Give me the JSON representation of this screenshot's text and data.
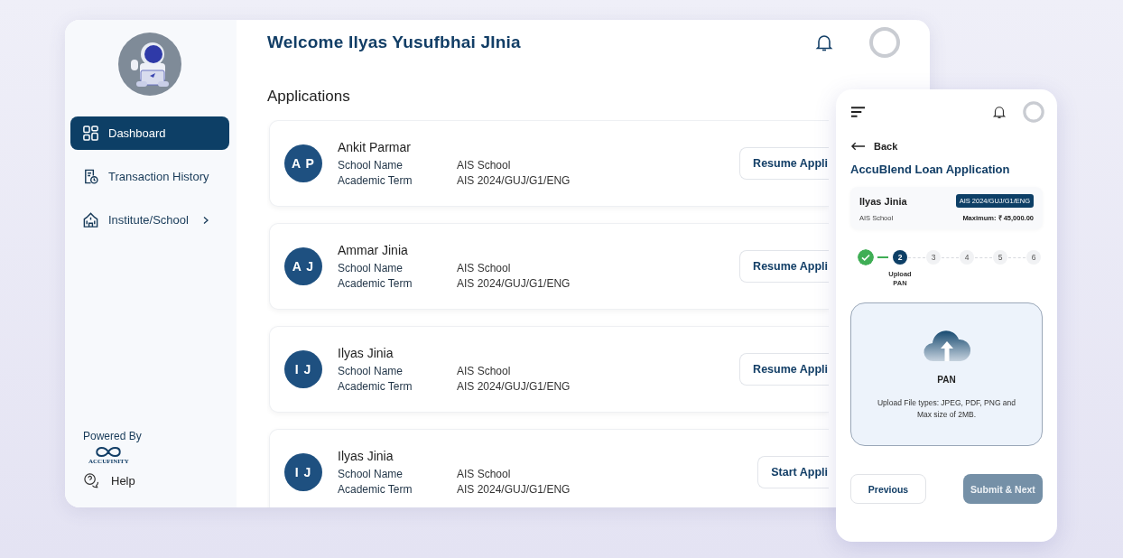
{
  "sidebar": {
    "items": [
      {
        "label": "Dashboard",
        "selected": true,
        "has_submenu": false
      },
      {
        "label": "Transaction History",
        "selected": false,
        "has_submenu": false
      },
      {
        "label": "Institute/School",
        "selected": false,
        "has_submenu": true
      }
    ],
    "powered_by": "Powered By",
    "brand": "ACCUFINITY",
    "help": "Help"
  },
  "header": {
    "welcome": "Welcome Ilyas Yusufbhai JInia"
  },
  "applications": {
    "title": "Applications",
    "items": [
      {
        "initials": "A P",
        "name": "Ankit Parmar",
        "fields": [
          {
            "label": "School Name",
            "value": "AIS School"
          },
          {
            "label": "Academic Term",
            "value": "AIS 2024/GUJ/G1/ENG"
          }
        ],
        "action": "Resume Appli"
      },
      {
        "initials": "A J",
        "name": "Ammar Jinia",
        "fields": [
          {
            "label": "School Name",
            "value": "AIS School"
          },
          {
            "label": "Academic Term",
            "value": "AIS 2024/GUJ/G1/ENG"
          }
        ],
        "action": "Resume Appli"
      },
      {
        "initials": "I J",
        "name": "Ilyas Jinia",
        "fields": [
          {
            "label": "School Name",
            "value": "AIS School"
          },
          {
            "label": "Academic Term",
            "value": "AIS 2024/GUJ/G1/ENG"
          }
        ],
        "action": "Resume Appli"
      },
      {
        "initials": "I J",
        "name": "Ilyas Jinia",
        "fields": [
          {
            "label": "School Name",
            "value": "AIS School"
          },
          {
            "label": "Academic Term",
            "value": "AIS 2024/GUJ/G1/ENG"
          }
        ],
        "action": "Start Appli"
      }
    ]
  },
  "mobile": {
    "back": "Back",
    "title": "AccuBlend Loan Application",
    "student": {
      "name": "Ilyas Jinia",
      "school": "AIS School",
      "term": "AIS 2024/GUJ/G1/ENG",
      "maximum": "Maximum: ₹ 45,000.00"
    },
    "steps": [
      {
        "completed": true,
        "selected": false
      },
      {
        "label": "2",
        "completed": false,
        "selected": true,
        "caption": "Upload PAN"
      },
      {
        "label": "3",
        "completed": false,
        "selected": false
      },
      {
        "label": "4",
        "completed": false,
        "selected": false
      },
      {
        "label": "5",
        "completed": false,
        "selected": false
      },
      {
        "label": "6",
        "completed": false,
        "selected": false
      }
    ],
    "upload": {
      "title": "PAN",
      "hint": "Upload File types: JPEG, PDF, PNG and Max size of 2MB."
    },
    "buttons": [
      {
        "label": "Previous",
        "kind": "outline",
        "disabled": false
      },
      {
        "label": "Submit & Next",
        "kind": "filled",
        "disabled": true
      }
    ]
  }
}
